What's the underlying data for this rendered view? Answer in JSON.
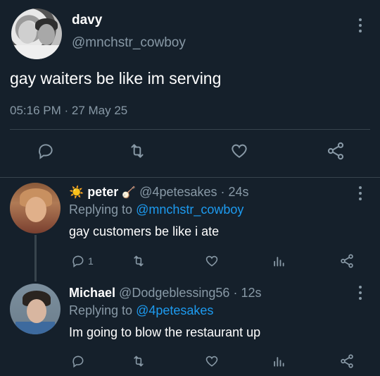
{
  "main_tweet": {
    "display_name": "davy",
    "handle": "@mnchstr_cowboy",
    "text": "gay waiters be like im serving",
    "timestamp": "05:16 PM · 27 May 25"
  },
  "replies": [
    {
      "display_name": "peter",
      "name_prefix_emoji": "☀️",
      "name_suffix_emoji": "🪕",
      "handle": "@4petesakes",
      "age": "· 24s",
      "replying_label": "Replying to",
      "replying_to": "@mnchstr_cowboy",
      "text": "gay customers be like i ate",
      "reply_count": "1"
    },
    {
      "display_name": "Michael",
      "handle": "@Dodgeblessing56",
      "age": "· 12s",
      "replying_label": "Replying to",
      "replying_to": "@4petesakes",
      "text": "Im going to blow the restaurant up",
      "reply_count": ""
    }
  ],
  "icons": {
    "reply": "reply-icon",
    "retweet": "retweet-icon",
    "like": "heart-icon",
    "share": "share-icon",
    "analytics": "analytics-icon",
    "more": "more-icon"
  },
  "colors": {
    "background": "#15202b",
    "muted": "#8899a6",
    "link": "#1d9bf0",
    "divider": "#38444d"
  }
}
